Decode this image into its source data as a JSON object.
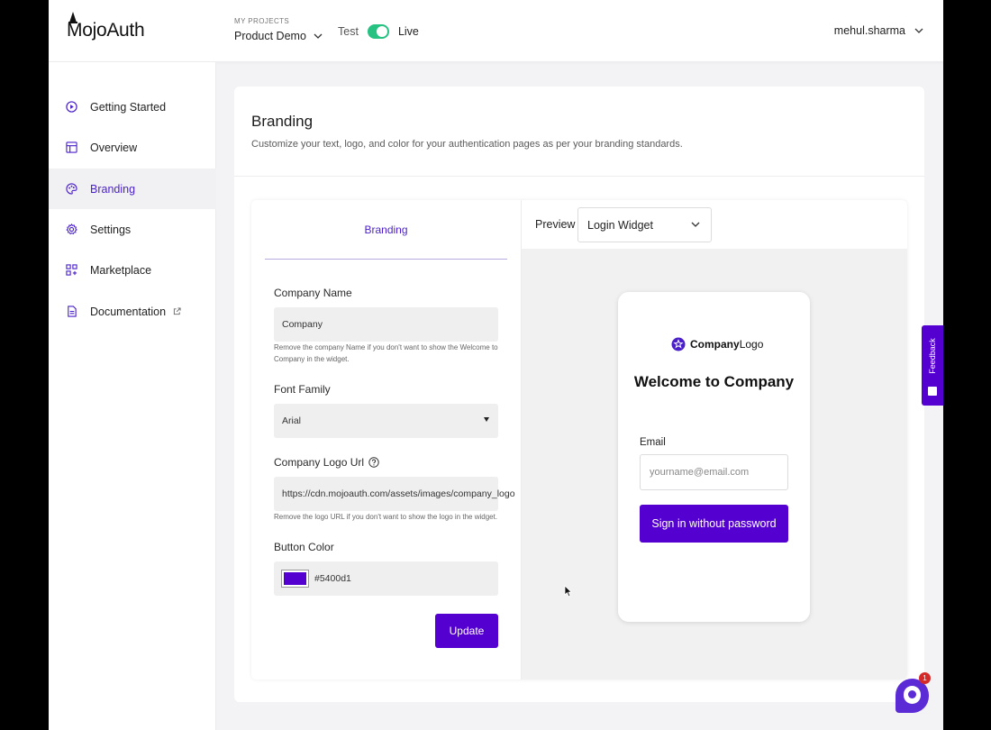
{
  "app": {
    "name": "MojoAuth"
  },
  "topbar": {
    "projects_label": "MY PROJECTS",
    "project_name": "Product Demo",
    "env_test": "Test",
    "env_live": "Live",
    "env_live_enabled": true,
    "username": "mehul.sharma"
  },
  "sidebar": {
    "items": [
      {
        "label": "Getting Started",
        "icon": "play-circle-icon"
      },
      {
        "label": "Overview",
        "icon": "dashboard-icon"
      },
      {
        "label": "Branding",
        "icon": "palette-icon",
        "active": true
      },
      {
        "label": "Settings",
        "icon": "gear-icon"
      },
      {
        "label": "Marketplace",
        "icon": "grid-plus-icon"
      },
      {
        "label": "Documentation",
        "icon": "document-icon",
        "external": true
      }
    ]
  },
  "page": {
    "title": "Branding",
    "subtitle": "Customize your text, logo, and color for your authentication pages as per your branding standards."
  },
  "form": {
    "tab_label": "Branding",
    "company_name": {
      "label": "Company Name",
      "value": "Company",
      "help": "Remove the company Name if you don't want to show the Welcome to Company in the widget."
    },
    "font_family": {
      "label": "Font Family",
      "value": "Arial"
    },
    "logo_url": {
      "label": "Company Logo Url",
      "value": "https://cdn.mojoauth.com/assets/images/company_logo",
      "help": "Remove the logo URL if you don't want to show the logo in the widget."
    },
    "button_color": {
      "label": "Button Color",
      "value": "#5400d1"
    },
    "update_label": "Update"
  },
  "preview": {
    "label": "Preview",
    "selected": "Login Widget",
    "widget": {
      "logo_bold": "Company",
      "logo_light": "Logo",
      "welcome": "Welcome to Company",
      "email_label": "Email",
      "email_placeholder": "yourname@email.com",
      "signin_label": "Sign in without password"
    }
  },
  "feedback_label": "Feedback",
  "chat_badge": "1",
  "colors": {
    "accent": "#5400d1",
    "toggle_on": "#26c281"
  }
}
